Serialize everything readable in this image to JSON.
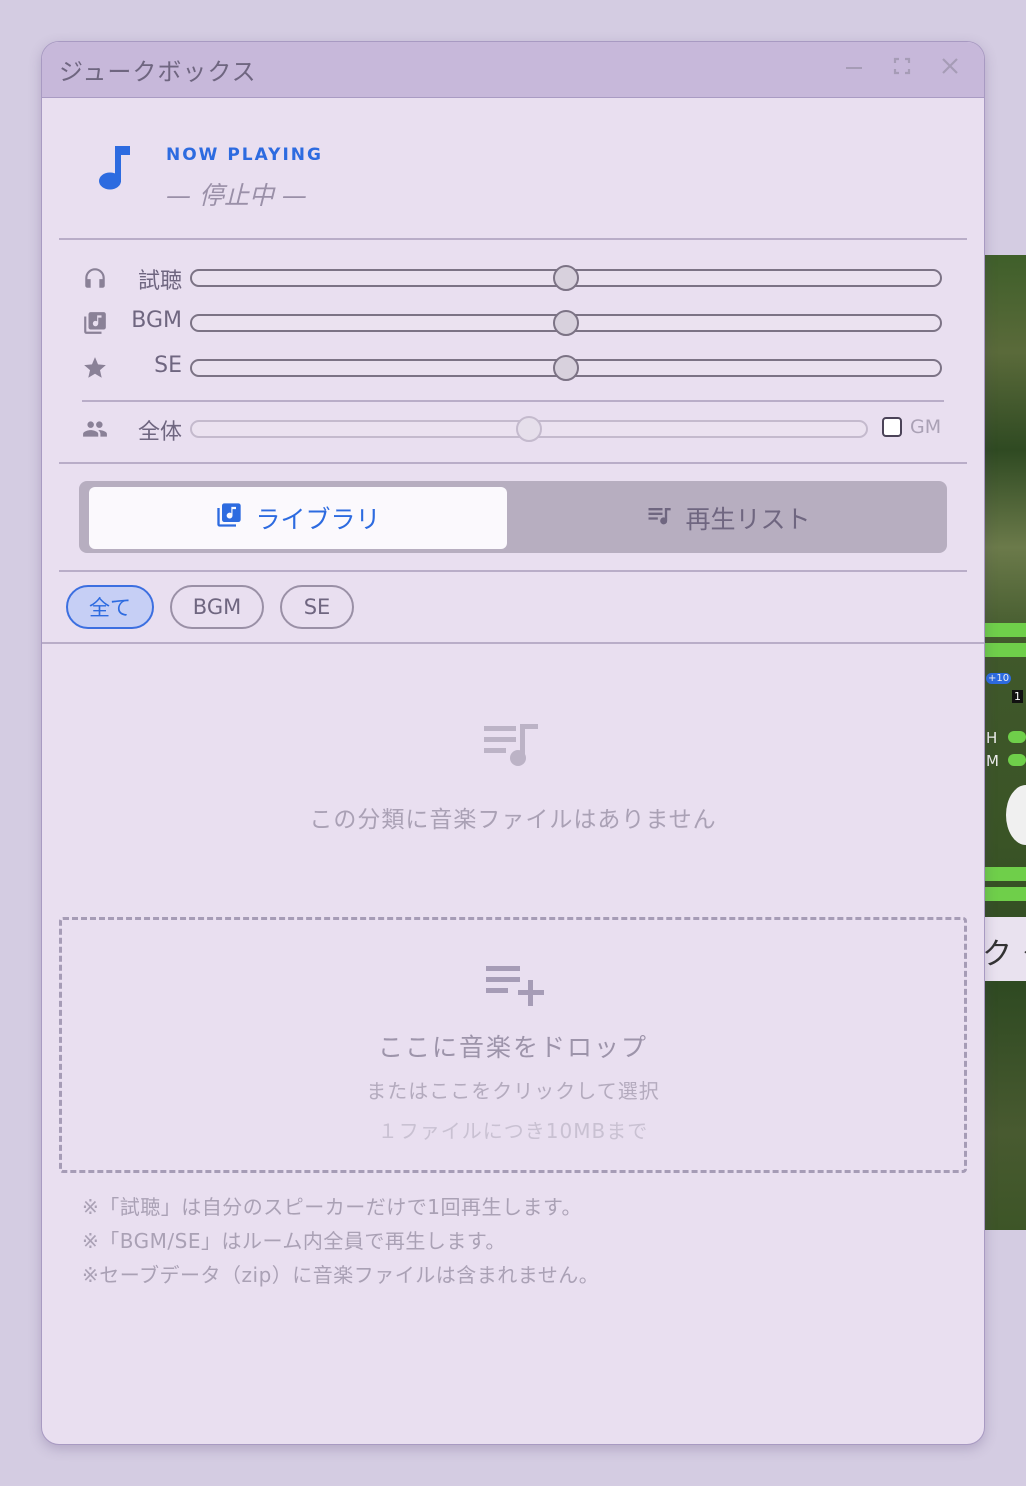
{
  "window": {
    "title": "ジュークボックス"
  },
  "now_playing": {
    "label": "NOW PLAYING",
    "title": "— 停止中 —"
  },
  "volume": {
    "rows": [
      {
        "label": "試聴",
        "icon": "headphones-icon",
        "value": 0.5
      },
      {
        "label": "BGM",
        "icon": "music-library-icon",
        "value": 0.5
      },
      {
        "label": "SE",
        "icon": "star-icon",
        "value": 0.5
      },
      {
        "label": "全体",
        "icon": "people-icon",
        "value": 0.5
      }
    ],
    "gm_label": "GM",
    "gm_checked": false
  },
  "tabs": [
    {
      "label": "ライブラリ",
      "icon": "music-library-icon",
      "active": true
    },
    {
      "label": "再生リスト",
      "icon": "playlist-icon",
      "active": false
    }
  ],
  "filters": [
    {
      "label": "全て",
      "active": true
    },
    {
      "label": "BGM",
      "active": false
    },
    {
      "label": "SE",
      "active": false
    }
  ],
  "empty_message": "この分類に音楽ファイルはありません",
  "dropzone": {
    "title": "ここに音楽をドロップ",
    "subtitle": "またはここをクリックして選択",
    "limit": "１ファイルにつき10MBまで"
  },
  "notes": [
    "※「試聴」は自分のスピーカーだけで1回再生します。",
    "※「BGM/SE」はルーム内全員で再生します。",
    "※セーブデータ（zip）に音楽ファイルは含まれません。"
  ],
  "colors": {
    "accent": "#2d6be0",
    "window_bg": "#e9dff0",
    "titlebar_bg": "#c7b8da"
  },
  "background": {
    "visible_text": [
      "+10",
      "1",
      "H",
      "M",
      "ク タ"
    ]
  }
}
